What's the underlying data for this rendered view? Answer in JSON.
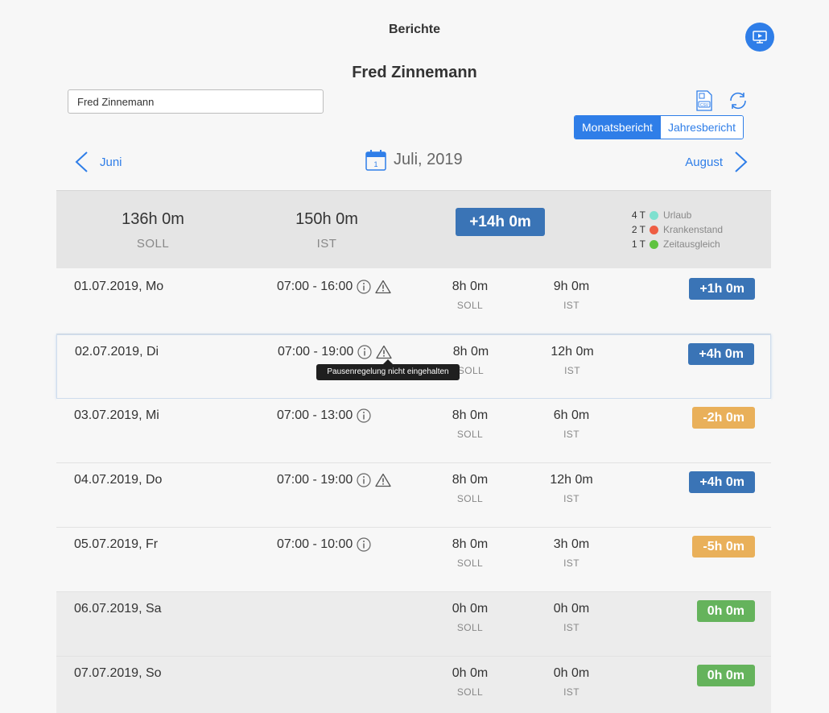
{
  "header": {
    "title": "Berichte",
    "video_icon": "monitor-play-icon"
  },
  "employee": {
    "name": "Fred Zinnemann",
    "input_value": "Fred Zinnemann"
  },
  "toolbar": {
    "csv_icon": "csv-file-icon",
    "refresh_icon": "refresh-icon"
  },
  "view_toggle": {
    "monthly": "Monatsbericht",
    "yearly": "Jahresbericht",
    "active": "Monatsbericht"
  },
  "month_nav": {
    "prev": "Juni",
    "current": "Juli, 2019",
    "next": "August"
  },
  "summary": {
    "soll_value": "136h 0m",
    "soll_label": "SOLL",
    "ist_value": "150h 0m",
    "ist_label": "IST",
    "balance": "+14h 0m",
    "legend": [
      {
        "count": "4 T",
        "label": "Urlaub",
        "color": "#7fe0cf"
      },
      {
        "count": "2 T",
        "label": "Krankenstand",
        "color": "#ee5d43"
      },
      {
        "count": "1 T",
        "label": "Zeitausgleich",
        "color": "#5fc33f"
      }
    ]
  },
  "days": [
    {
      "date": "01.07.2019, Mo",
      "time": "07:00 - 16:00",
      "info": true,
      "warning": true,
      "soll": "8h 0m",
      "ist": "9h 0m",
      "diff": "+1h 0m",
      "diff_color": "blue"
    },
    {
      "date": "02.07.2019, Di",
      "time": "07:00 - 19:00",
      "info": true,
      "warning": true,
      "soll": "8h 0m",
      "ist": "12h 0m",
      "diff": "+4h 0m",
      "diff_color": "blue"
    },
    {
      "date": "03.07.2019, Mi",
      "time": "07:00 - 13:00",
      "info": true,
      "warning": false,
      "soll": "8h 0m",
      "ist": "6h 0m",
      "diff": "-2h 0m",
      "diff_color": "orange"
    },
    {
      "date": "04.07.2019, Do",
      "time": "07:00 - 19:00",
      "info": true,
      "warning": true,
      "soll": "8h 0m",
      "ist": "12h 0m",
      "diff": "+4h 0m",
      "diff_color": "blue"
    },
    {
      "date": "05.07.2019, Fr",
      "time": "07:00 - 10:00",
      "info": true,
      "warning": false,
      "soll": "8h 0m",
      "ist": "3h 0m",
      "diff": "-5h 0m",
      "diff_color": "orange"
    },
    {
      "date": "06.07.2019, Sa",
      "time": "",
      "info": false,
      "warning": false,
      "soll": "0h 0m",
      "ist": "0h 0m",
      "diff": "0h 0m",
      "diff_color": "green"
    },
    {
      "date": "07.07.2019, So",
      "time": "",
      "info": false,
      "warning": false,
      "soll": "0h 0m",
      "ist": "0h 0m",
      "diff": "0h 0m",
      "diff_color": "green"
    }
  ],
  "labels": {
    "soll": "SOLL",
    "ist": "IST"
  },
  "tooltip": {
    "text": "Pausenregelung nicht eingehalten"
  }
}
